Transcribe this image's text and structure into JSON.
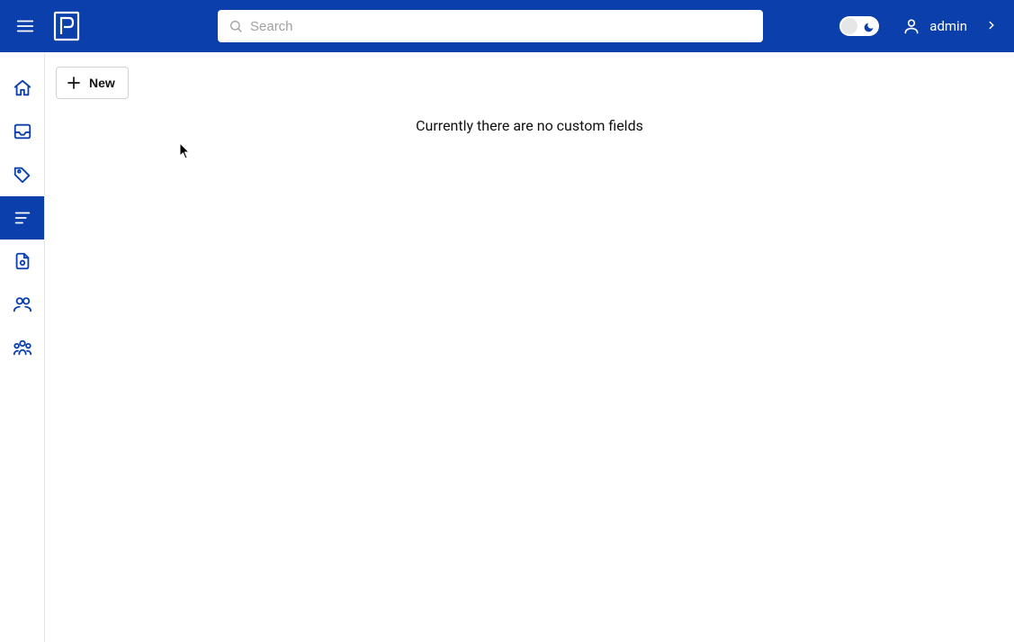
{
  "header": {
    "search_placeholder": "Search",
    "username": "admin"
  },
  "sidebar": {
    "items": [
      {
        "name": "home"
      },
      {
        "name": "inbox"
      },
      {
        "name": "tags"
      },
      {
        "name": "custom-fields"
      },
      {
        "name": "file-badge"
      },
      {
        "name": "users"
      },
      {
        "name": "groups"
      }
    ],
    "active_index": 3
  },
  "toolbar": {
    "new_label": "New"
  },
  "main": {
    "empty_message": "Currently there are no custom fields"
  }
}
